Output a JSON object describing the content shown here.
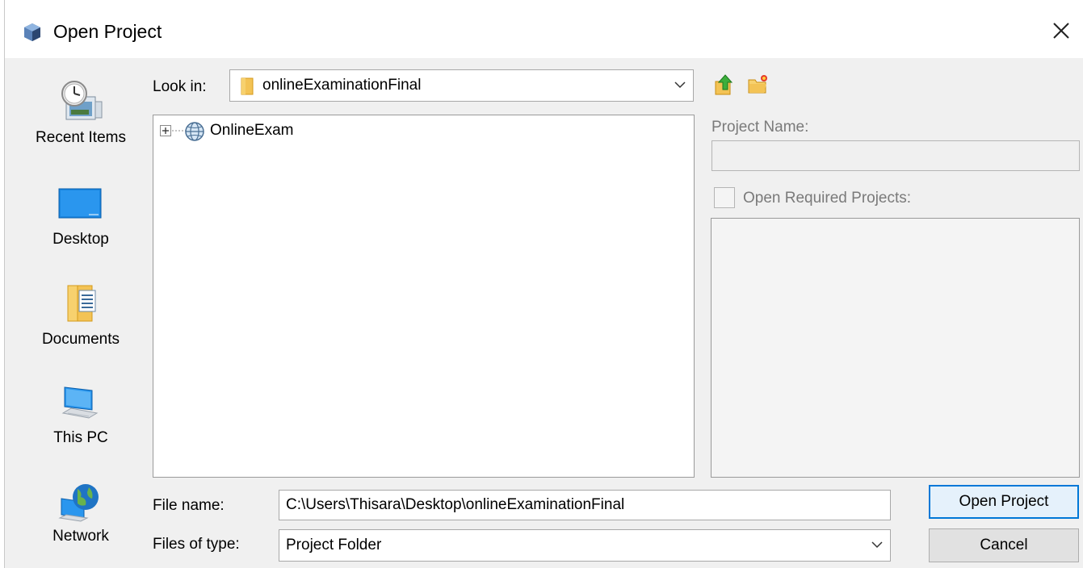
{
  "window": {
    "title": "Open Project",
    "app_icon": "project-cube-icon",
    "close_icon": "close-icon"
  },
  "places": [
    {
      "label": "Recent Items",
      "icon": "recent-items-clock-icon"
    },
    {
      "label": "Desktop",
      "icon": "desktop-monitor-icon"
    },
    {
      "label": "Documents",
      "icon": "documents-folder-icon"
    },
    {
      "label": "This PC",
      "icon": "computer-icon"
    },
    {
      "label": "Network",
      "icon": "network-globe-icon"
    }
  ],
  "look_in": {
    "label": "Look in:",
    "value": "onlineExaminationFinal",
    "icon": "folder-icon"
  },
  "toolbar": {
    "up_icon": "up-one-level-icon",
    "new_folder_icon": "new-folder-icon"
  },
  "tree": {
    "items": [
      {
        "name": "OnlineExam",
        "icon": "web-project-globe-icon",
        "expander": "plus-expand-icon"
      }
    ]
  },
  "project_name": {
    "label": "Project Name:",
    "value": ""
  },
  "open_required": {
    "label": "Open Required Projects:",
    "checked": false
  },
  "file_name": {
    "label": "File name:",
    "value": "C:\\Users\\Thisara\\Desktop\\onlineExaminationFinal"
  },
  "files_of_type": {
    "label": "Files of type:",
    "value": "Project Folder"
  },
  "buttons": {
    "open_label": "Open Project",
    "cancel_label": "Cancel"
  },
  "colors": {
    "accent": "#0078d7",
    "dialog_bg": "#f0f0f0",
    "disabled_text": "#7a7a7a"
  }
}
